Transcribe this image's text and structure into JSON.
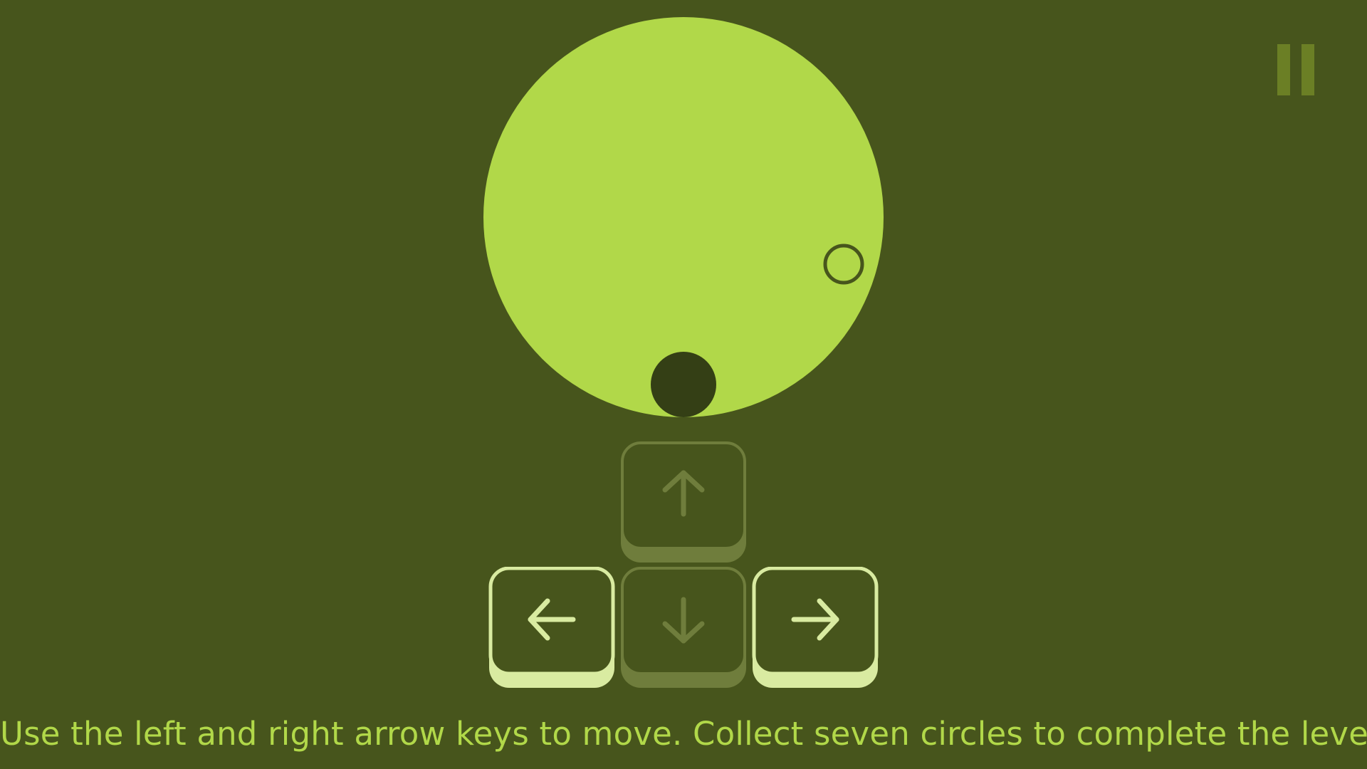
{
  "game": {
    "pause_icon": "pause-icon",
    "colors": {
      "background": "#47551c",
      "arena": "#b1d849",
      "player": "#343f15",
      "target_ring": "#47551c",
      "key_active": "#d9eba1",
      "key_inactive": "#6f7d3c",
      "text": "#b1d849"
    }
  },
  "controls": {
    "up": {
      "icon": "arrow-up-icon",
      "active": false
    },
    "down": {
      "icon": "arrow-down-icon",
      "active": false
    },
    "left": {
      "icon": "arrow-left-icon",
      "active": true
    },
    "right": {
      "icon": "arrow-right-icon",
      "active": true
    }
  },
  "instructions": "Use the left and right arrow keys to move. Collect seven circles to complete the level."
}
